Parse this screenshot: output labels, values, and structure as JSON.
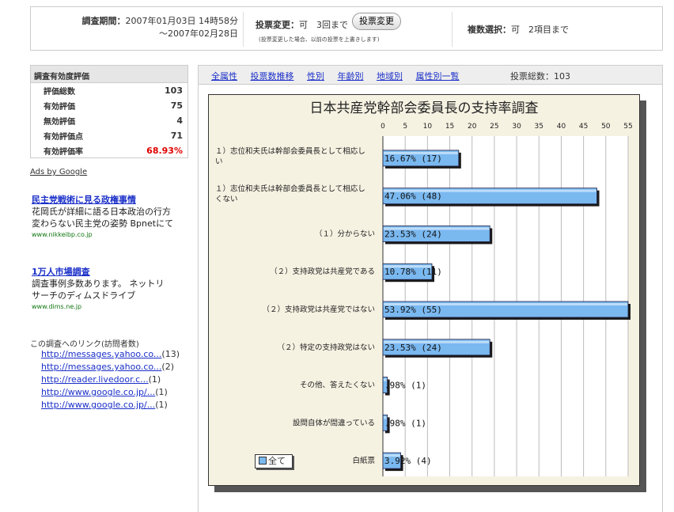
{
  "period": {
    "label": "調査期間：",
    "start": "2007年01月03日 14時58分",
    "end": "～2007年02月28日"
  },
  "vote_change": {
    "label": "投票変更：",
    "value": "可　3回まで",
    "button": "投票変更",
    "note": "(投票変更した場合、以前の投票を上書きします)"
  },
  "multi_select": {
    "label": "複数選択：",
    "value": "可　2項目まで"
  },
  "stats": {
    "header": "調査有効度評価",
    "rows": [
      {
        "label": "評価総数",
        "value": "103"
      },
      {
        "label": "有効評価",
        "value": "75"
      },
      {
        "label": "無効評価",
        "value": "4"
      },
      {
        "label": "有効評価点",
        "value": "71"
      },
      {
        "label": "有効評価率",
        "value": "68.93%"
      }
    ]
  },
  "ads": {
    "title": "Ads by Google",
    "items": [
      {
        "title": "民主党戦術に見る政権事情",
        "desc1": "花岡氏が詳細に語る日本政治の行方",
        "desc2": "変わらない民主党の姿勢 Bpnetにて",
        "url": "www.nikkeibp.co.jp"
      },
      {
        "title": "1万人市場調査",
        "desc1": "調査事例多数あります。 ネットリ",
        "desc2": "サーチのディムスドライブ",
        "url": "www.dims.ne.jp"
      }
    ]
  },
  "links": {
    "title": "この調査へのリンク(訪問者数)",
    "items": [
      {
        "url": "http://messages.yahoo.co...",
        "count": "(13)"
      },
      {
        "url": "http://messages.yahoo.co...",
        "count": "(2)"
      },
      {
        "url": "http://reader.livedoor.c...",
        "count": "(1)"
      },
      {
        "url": "http://www.google.co.jp/...",
        "count": "(1)"
      },
      {
        "url": "http://www.google.co.jp/...",
        "count": "(1)"
      }
    ]
  },
  "tabs": {
    "items": [
      "全属性",
      "投票数推移",
      "性別",
      "年齢別",
      "地域別",
      "属性別一覧"
    ],
    "total": "投票総数：103"
  },
  "legend": "全て",
  "colors": {
    "bar": "#7ab8f0",
    "bar_shadow": "#1a1a1a",
    "accent_red": "#e00000",
    "link": "#1a2fc8"
  },
  "chart_data": {
    "type": "bar",
    "orientation": "horizontal",
    "title": "日本共産党幹部会委員長の支持率調査",
    "xlim": [
      0,
      55
    ],
    "ticks": [
      0,
      5,
      10,
      15,
      20,
      25,
      30,
      35,
      40,
      45,
      50,
      55
    ],
    "grid": true,
    "categories": [
      "１）志位和夫氏は幹部会委員長として相応しい",
      "１）志位和夫氏は幹部会委員長として相応しくない",
      "（１）分からない",
      "（２）支持政党は共産党である",
      "（２）支持政党は共産党ではない",
      "（２）特定の支持政党はない",
      "その他、答えたくない",
      "設問自体が間違っている",
      "白紙票"
    ],
    "values": [
      17,
      48,
      24,
      11,
      55,
      24,
      1,
      1,
      4
    ],
    "labels": [
      "16.67% (17)",
      "47.06% (48)",
      "23.53% (24)",
      "10.78% (11)",
      "53.92% (55)",
      "23.53% (24)",
      ".98% (1)",
      ".98% (1)",
      "3.92% (4)"
    ],
    "legend": [
      "全て"
    ]
  }
}
